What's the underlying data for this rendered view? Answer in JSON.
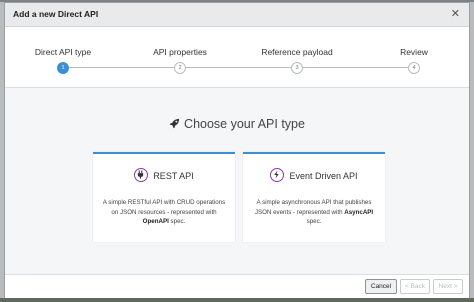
{
  "dialog": {
    "title": "Add a new Direct API",
    "close_symbol": "✕"
  },
  "stepper": {
    "steps": [
      {
        "label": "Direct API type",
        "number": "1",
        "active": true
      },
      {
        "label": "API properties",
        "number": "2",
        "active": false
      },
      {
        "label": "Reference payload",
        "number": "3",
        "active": false
      },
      {
        "label": "Review",
        "number": "4",
        "active": false
      }
    ]
  },
  "main": {
    "heading": "Choose your API type",
    "heading_icon": "rocket-icon",
    "cards": [
      {
        "title": "REST API",
        "icon": "plug-icon",
        "desc_pre": "A simple RESTful API with CRUD operations on JSON resources - represented with ",
        "desc_bold": "OpenAPI",
        "desc_post": " spec."
      },
      {
        "title": "Event Driven API",
        "icon": "lightning-icon",
        "desc_pre": "A simple asynchronous API that publishes JSON events - represented with ",
        "desc_bold": "AsyncAPI",
        "desc_post": " spec."
      }
    ]
  },
  "footer": {
    "cancel_label": "Cancel",
    "back_label": "< Back",
    "next_label": "Next >"
  },
  "colors": {
    "accent": "#3c8fd3",
    "icon_purple": "#8a3aa8"
  }
}
